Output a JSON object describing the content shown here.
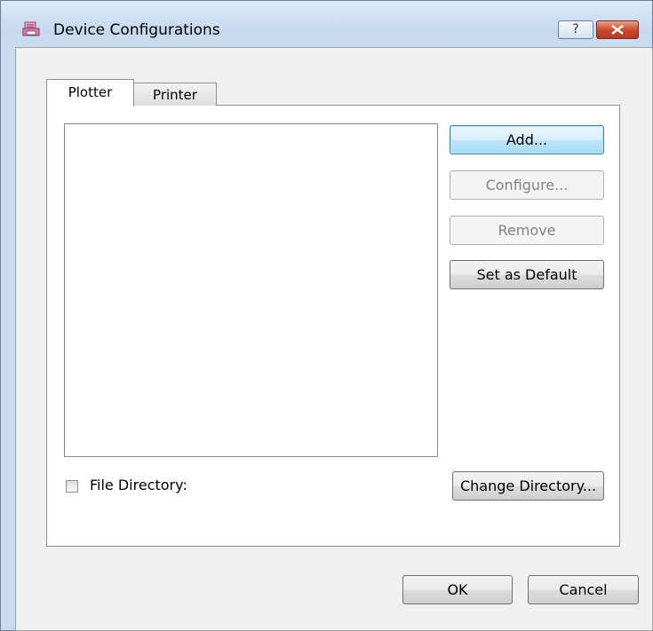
{
  "window": {
    "title": "Device Configurations",
    "help_label": "?",
    "icon": "printer-config-icon",
    "close_icon": "close-icon"
  },
  "tabs": [
    {
      "label": "Plotter",
      "active": true
    },
    {
      "label": "Printer",
      "active": false
    }
  ],
  "buttons": {
    "add": "Add...",
    "configure": "Configure...",
    "remove": "Remove",
    "set_default": "Set as Default",
    "change_directory": "Change Directory...",
    "ok": "OK",
    "cancel": "Cancel"
  },
  "file_directory": {
    "label": "File Directory:",
    "checked": false
  },
  "colors": {
    "frame": "#c9dbee",
    "client_bg": "#f0f0f0",
    "close_red": "#c9452b",
    "default_btn_border": "#3c7fb1"
  }
}
